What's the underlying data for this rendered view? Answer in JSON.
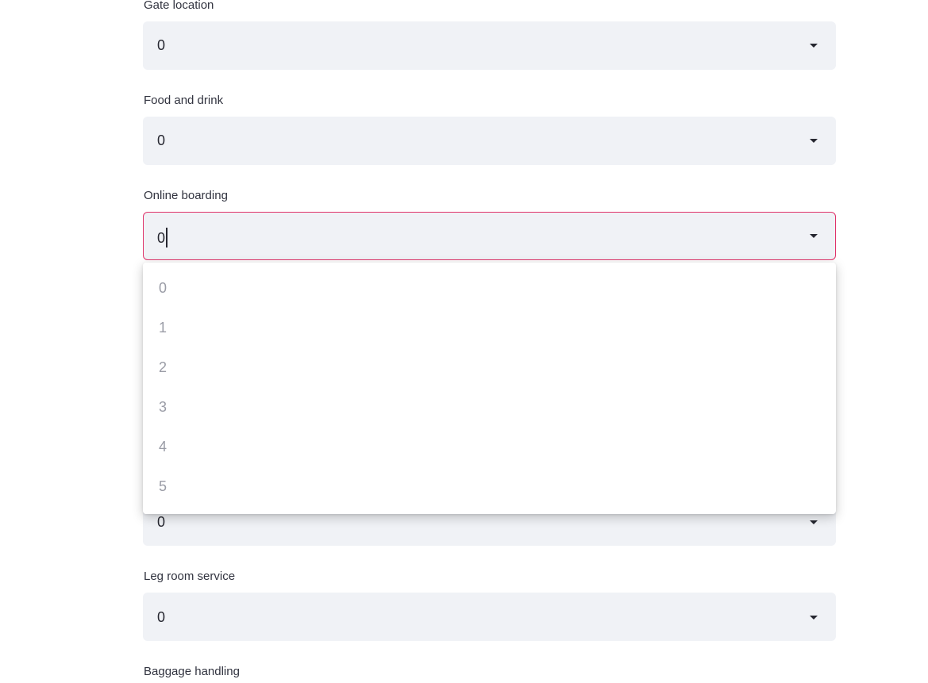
{
  "fields": [
    {
      "label": "Gate location",
      "value": "0"
    },
    {
      "label": "Food and drink",
      "value": "0"
    },
    {
      "label": "Online boarding",
      "value": "0"
    },
    {
      "label": "",
      "value": "0"
    },
    {
      "label": "Leg room service",
      "value": "0"
    },
    {
      "label": "Baggage handling",
      "value": ""
    }
  ],
  "dropdown": {
    "options": [
      "0",
      "1",
      "2",
      "3",
      "4",
      "5"
    ]
  },
  "colors": {
    "focus_border": "#e0336a",
    "field_bg": "#f0f2f6",
    "option_text": "#9a9ca6"
  },
  "icons": {
    "select_arrow": "chevron-down-icon"
  }
}
